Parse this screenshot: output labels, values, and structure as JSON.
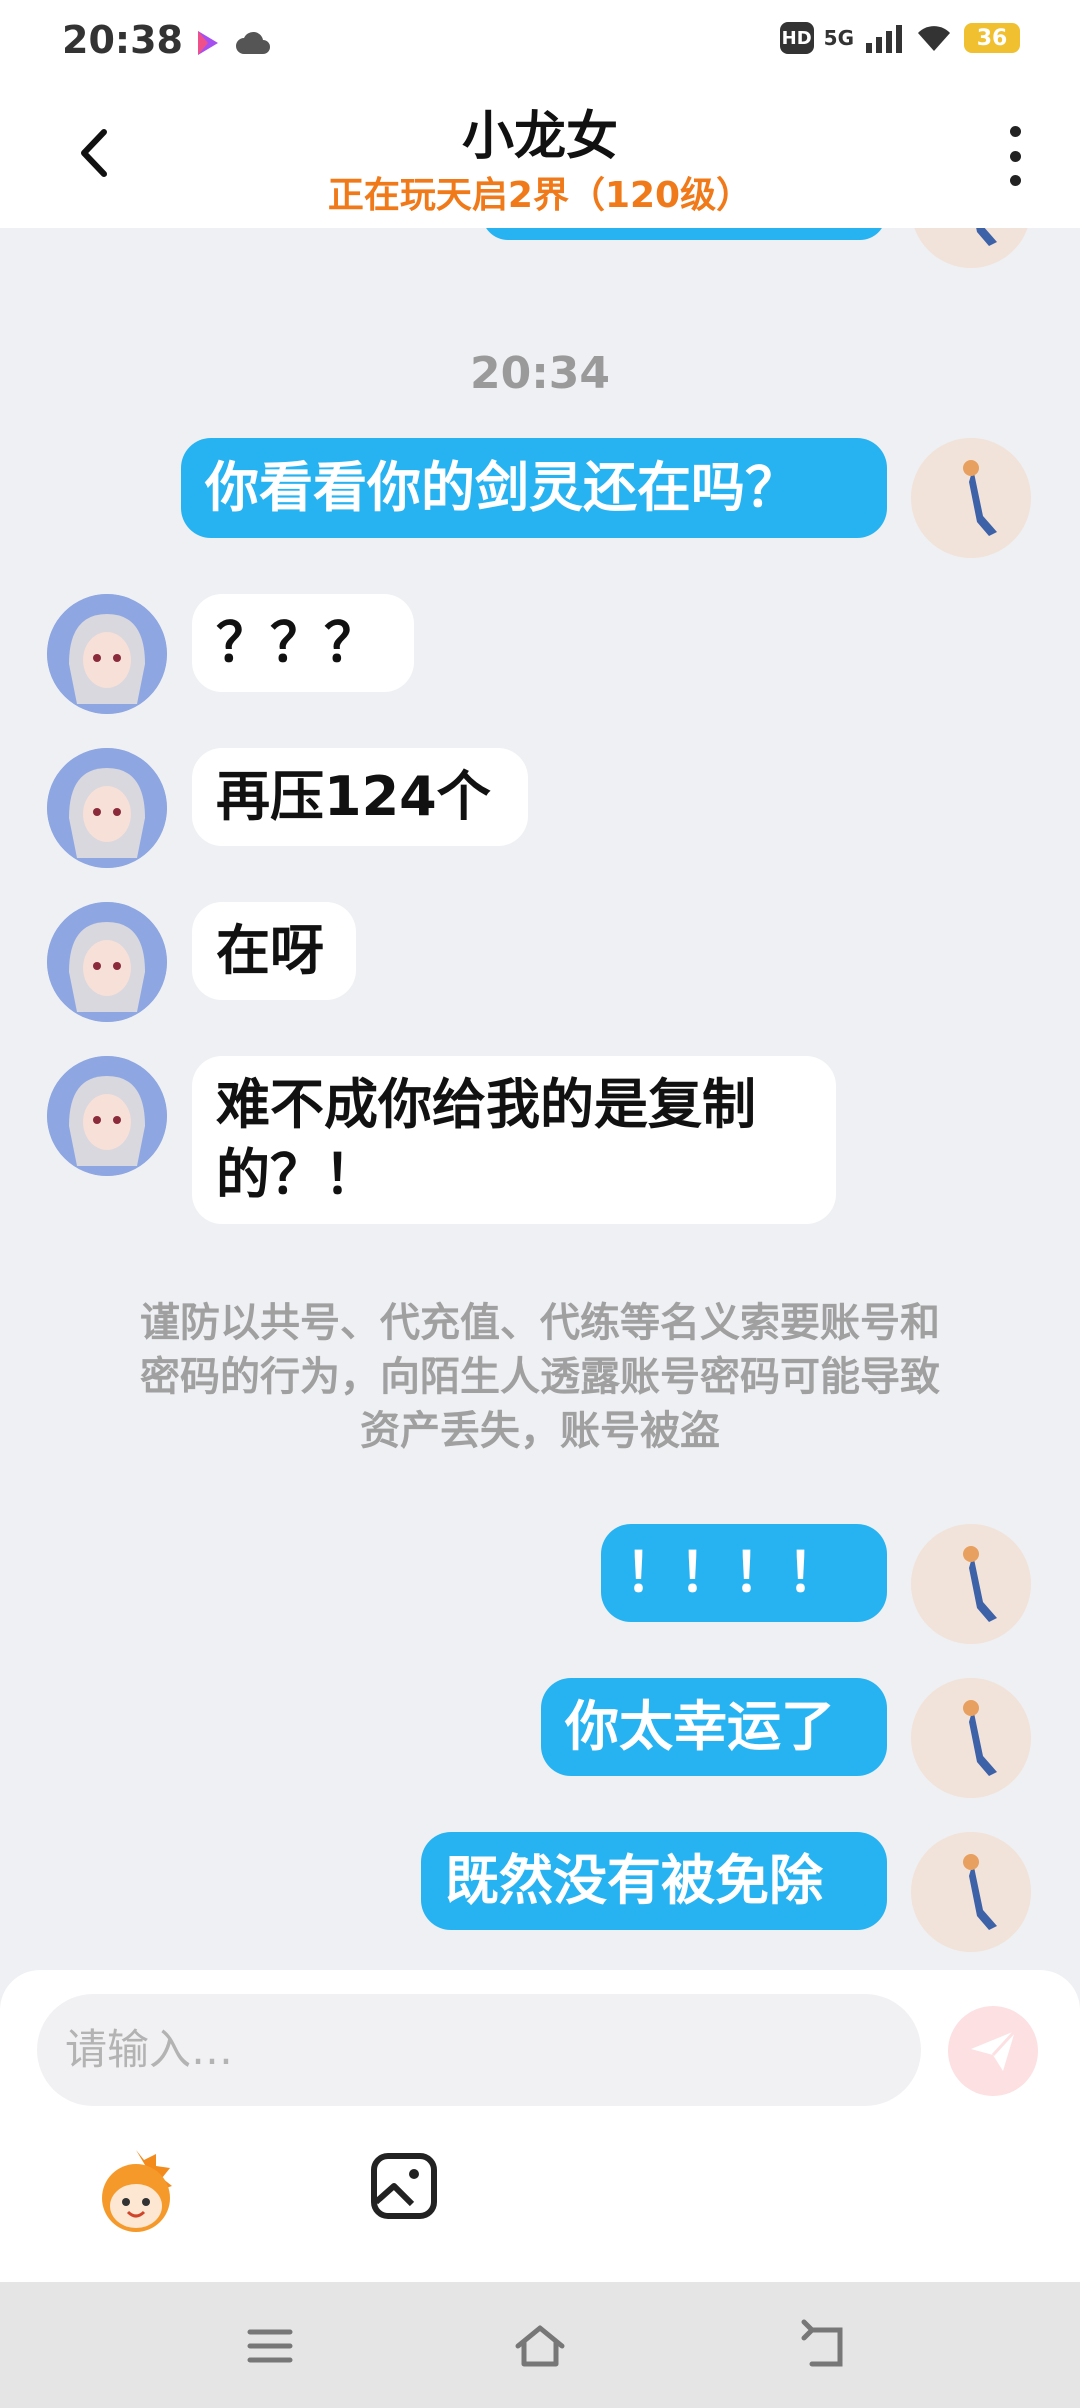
{
  "status_bar": {
    "time": "20:38",
    "hd": "HD",
    "network": "5G",
    "battery": "36"
  },
  "header": {
    "title": "小龙女",
    "subtitle": "正在玩天启2界（120级）"
  },
  "chat": {
    "timestamp": "20:34",
    "messages": [
      {
        "from": "me",
        "text": "你看看你的剑灵还在吗？"
      },
      {
        "from": "them",
        "text": "？？？"
      },
      {
        "from": "them",
        "text": "再压124个"
      },
      {
        "from": "them",
        "text": "在呀"
      },
      {
        "from": "them",
        "line1": "难不成你给我的是复制",
        "line2": "的？！"
      },
      {
        "from": "me",
        "text": "！！！！"
      },
      {
        "from": "me",
        "text": "你太幸运了"
      },
      {
        "from": "me",
        "text": "既然没有被免除"
      }
    ],
    "notice": {
      "line1": "谨防以共号、代充值、代练等名义索要账号和",
      "line2": "密码的行为，向陌生人透露账号密码可能导致",
      "line3": "资产丢失，账号被盗"
    }
  },
  "input": {
    "placeholder": "请输入…"
  },
  "colors": {
    "my_bubble": "#27b3f2",
    "their_bubble": "#ffffff",
    "subtitle": "#f07a1a",
    "background": "#eef0f3"
  },
  "icons": [
    "back-icon",
    "more-icon",
    "send-icon",
    "emoji-icon",
    "image-icon",
    "menu-icon",
    "home-icon",
    "back-nav-icon"
  ]
}
